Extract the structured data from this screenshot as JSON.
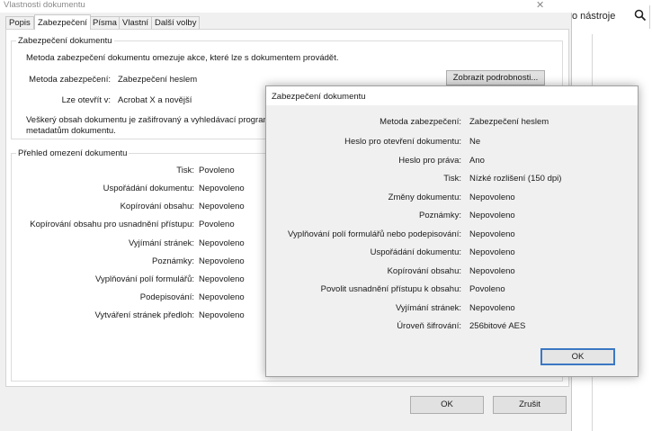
{
  "background_app": {
    "tools_label": "o nástroje"
  },
  "dialog": {
    "title": "Vlastnosti dokumentu",
    "close_glyph": "✕",
    "tabs": [
      "Popis",
      "Zabezpečení",
      "Písma",
      "Vlastní",
      "Další volby"
    ],
    "security_group": {
      "legend": "Zabezpečení dokumentu",
      "description": "Metoda zabezpečení dokumentu omezuje akce, které lze s dokumentem provádět.",
      "method_label": "Metoda zabezpečení:",
      "method_value": "Zabezpečení heslem",
      "details_button": "Zobrazit podrobnosti...",
      "opens_label": "Lze otevřít v:",
      "opens_value": "Acrobat X a novější",
      "encrypt_note_line1": "Veškerý obsah dokumentu je zašifrovaný a vyhledávací programy ne",
      "encrypt_note_line2": "metadatům dokumentu."
    },
    "restrictions_group": {
      "legend": "Přehled omezení dokumentu",
      "rows": [
        {
          "label": "Tisk:",
          "value": "Povoleno"
        },
        {
          "label": "Uspořádání dokumentu:",
          "value": "Nepovoleno"
        },
        {
          "label": "Kopírování obsahu:",
          "value": "Nepovoleno"
        },
        {
          "label": "Kopírování obsahu pro usnadnění přístupu:",
          "value": "Povoleno"
        },
        {
          "label": "Vyjímání stránek:",
          "value": "Nepovoleno"
        },
        {
          "label": "Poznámky:",
          "value": "Nepovoleno"
        },
        {
          "label": "Vyplňování polí formulářů:",
          "value": "Nepovoleno"
        },
        {
          "label": "Podepisování:",
          "value": "Nepovoleno"
        },
        {
          "label": "Vytváření stránek předloh:",
          "value": "Nepovoleno"
        }
      ]
    },
    "ok_button": "OK",
    "cancel_button": "Zrušit"
  },
  "popup": {
    "title": "Zabezpečení dokumentu",
    "rows": [
      {
        "label": "Metoda zabezpečení:",
        "value": "Zabezpečení heslem"
      },
      {
        "label": "Heslo pro otevření dokumentu:",
        "value": "Ne"
      },
      {
        "label": "Heslo pro práva:",
        "value": "Ano"
      },
      {
        "label": "Tisk:",
        "value": "Nízké rozlišení (150 dpi)"
      },
      {
        "label": "Změny dokumentu:",
        "value": "Nepovoleno"
      },
      {
        "label": "Poznámky:",
        "value": "Nepovoleno"
      },
      {
        "label": "Vyplňování polí formulářů nebo podepisování:",
        "value": "Nepovoleno"
      },
      {
        "label": "Uspořádání dokumentu:",
        "value": "Nepovoleno"
      },
      {
        "label": "Kopírování obsahu:",
        "value": "Nepovoleno"
      },
      {
        "label": "Povolit usnadnění přístupu k obsahu:",
        "value": "Povoleno"
      },
      {
        "label": "Vyjímání stránek:",
        "value": "Nepovoleno"
      },
      {
        "label": "Úroveň šifrování:",
        "value": "256bitové AES"
      }
    ],
    "ok_button": "OK"
  }
}
